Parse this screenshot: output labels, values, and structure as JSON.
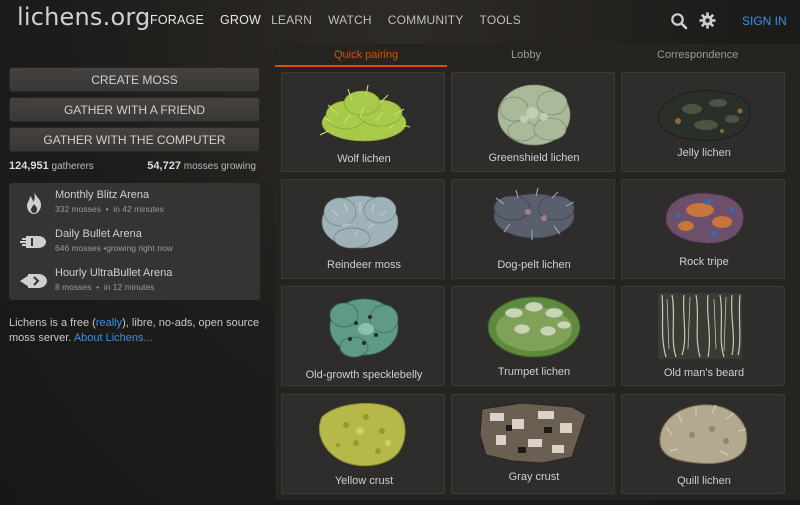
{
  "header": {
    "logo": "lichens.org",
    "nav": {
      "forage": "FORAGE",
      "grow": "GROW",
      "learn": "LEARN",
      "watch": "WATCH",
      "community": "COMMUNITY",
      "tools": "TOOLS"
    },
    "signin": "SIGN IN"
  },
  "lobby": {
    "create": "CREATE MOSS",
    "friend": "GATHER WITH A FRIEND",
    "computer": "GATHER WITH THE COMPUTER"
  },
  "counts": {
    "gatherers_num": "124,951",
    "gatherers_label": "gatherers",
    "mosses_num": "54,727",
    "mosses_label": "mosses growing"
  },
  "arenas": [
    {
      "title": "Monthly Blitz Arena",
      "count": "332 mosses",
      "sep": "•",
      "time": "in 42 minutes",
      "icon": "flame-icon"
    },
    {
      "title": "Daily Bullet Arena",
      "count": "646 mosses",
      "sep": "•",
      "time": "growing right now",
      "icon": "bullet-icon"
    },
    {
      "title": "Hourly UltraBullet Arena",
      "count": "8 mosses",
      "sep": "•",
      "time": "in 12 minutes",
      "icon": "ultrabullet-icon"
    }
  ],
  "about": {
    "pre": "Lichens is a free (",
    "really": "really",
    "mid": "), libre, no-ads, open source moss server.",
    "link": "About Lichens..."
  },
  "tabs": {
    "quick": "Quick pairing",
    "lobby": "Lobby",
    "correspondence": "Correspondence"
  },
  "pairings": [
    {
      "name": "Wolf lichen",
      "color": "#a8c94a"
    },
    {
      "name": "Greenshield lichen",
      "color": "#a9b99a"
    },
    {
      "name": "Jelly lichen",
      "color": "#2a2f2a"
    },
    {
      "name": "Reindeer moss",
      "color": "#9fb2b8"
    },
    {
      "name": "Dog-pelt lichen",
      "color": "#5a5f6e"
    },
    {
      "name": "Rock tripe",
      "color": "#6c4f6a"
    },
    {
      "name": "Old-growth specklebelly",
      "color": "#5f9a86"
    },
    {
      "name": "Trumpet lichen",
      "color": "#7fa258"
    },
    {
      "name": "Old man's beard",
      "color": "#c8cabb"
    },
    {
      "name": "Yellow crust",
      "color": "#b7b84a"
    },
    {
      "name": "Gray crust",
      "color": "#6b5f52"
    },
    {
      "name": "Quill lichen",
      "color": "#b2a98e"
    }
  ],
  "colors": {
    "accent": "#d85000",
    "link": "#3692e7"
  }
}
